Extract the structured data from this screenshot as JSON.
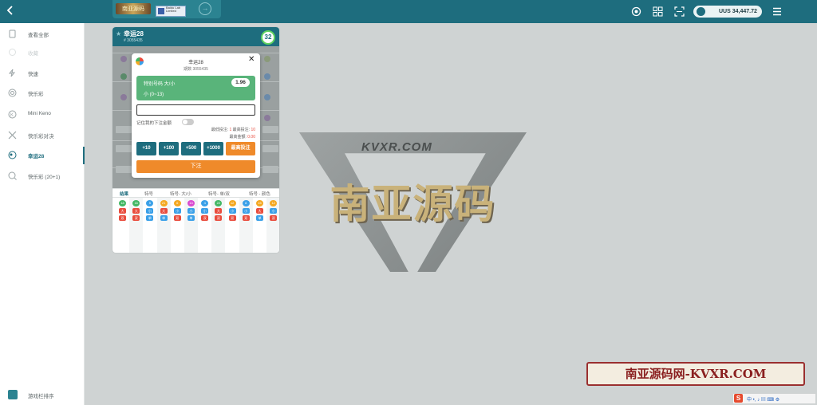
{
  "header": {
    "back_icon": "chevron-left-icon",
    "banner_logo_text": "南亚源码",
    "banner_mini_text": "Baidu Lab Limited",
    "balance": "UUS 34,447.72",
    "icons": [
      "settings-icon",
      "grid-icon",
      "scan-icon",
      "user-icon",
      "menu-icon"
    ]
  },
  "sidebar": {
    "items": [
      {
        "label": "查看全部",
        "icon": "bookmark-icon",
        "disabled": false
      },
      {
        "label": "收藏",
        "icon": "star-icon",
        "disabled": true
      },
      {
        "label": "快速",
        "icon": "lightning-icon",
        "disabled": false
      },
      {
        "label": "快乐彩",
        "icon": "lottery-icon",
        "disabled": false
      },
      {
        "label": "Mini Keno",
        "icon": "keno-icon",
        "disabled": false
      },
      {
        "label": "快乐彩对决",
        "icon": "versus-icon",
        "disabled": false
      },
      {
        "label": "幸运28",
        "icon": "lucky-icon",
        "disabled": false,
        "active": true
      },
      {
        "label": "快乐彩 (20+1)",
        "icon": "search-ball-icon",
        "disabled": false
      }
    ],
    "bottom_label": "游戏栏排序"
  },
  "card": {
    "game_name": "幸运28",
    "round": "# 3055435",
    "timer": "32",
    "tabs": [
      "结果",
      "特号",
      "特号- 大/小",
      "特号- 单/双",
      "特号 - 颜色"
    ],
    "history": [
      {
        "num": "18",
        "size": "大",
        "parity": "双",
        "color": "#42b763"
      },
      {
        "num": "16",
        "size": "大",
        "parity": "双",
        "color": "#42b763"
      },
      {
        "num": "5",
        "size": "小",
        "parity": "单",
        "color": "#3aa0e8"
      },
      {
        "num": "21",
        "size": "大",
        "parity": "单",
        "color": "#f4a821"
      },
      {
        "num": "6",
        "size": "小",
        "parity": "双",
        "color": "#f4a821"
      },
      {
        "num": "13",
        "size": "小",
        "parity": "单",
        "color": "#d94bd0"
      },
      {
        "num": "4",
        "size": "小",
        "parity": "双",
        "color": "#3aa0e8"
      },
      {
        "num": "22",
        "size": "大",
        "parity": "双",
        "color": "#42b763"
      },
      {
        "num": "12",
        "size": "小",
        "parity": "双",
        "color": "#f4a821"
      },
      {
        "num": "8",
        "size": "小",
        "parity": "双",
        "color": "#3aa0e8"
      },
      {
        "num": "15",
        "size": "大",
        "parity": "单",
        "color": "#f4a821"
      },
      {
        "num": "12",
        "size": "小",
        "parity": "双",
        "color": "#f4a821"
      }
    ]
  },
  "modal": {
    "title": "幸运28",
    "round": "期数 3055435",
    "selection_label": "特别号码 大/小",
    "selection_value": "小 (0~13)",
    "odds": "1.96",
    "amount_value": "",
    "remember_label": "记住我的下注金额",
    "limits_prefix": "最低投注: ",
    "min_bet": "1",
    "limits_mid": "  最高投注: ",
    "max_bet": "10",
    "max_win_label": "最高金额: ",
    "max_win": "0.00",
    "chips": [
      "+10",
      "+100",
      "+500",
      "+1000"
    ],
    "max_chip": "最高投注",
    "submit": "下注"
  },
  "watermark": {
    "site": "KVXR.COM",
    "big_text": "南亚源码",
    "stamp": "南亚源码网-KVXR.COM"
  },
  "tray": {
    "ime_icon": "S",
    "text": "中 •, ♪ ▤ ⌨ ⚙"
  }
}
